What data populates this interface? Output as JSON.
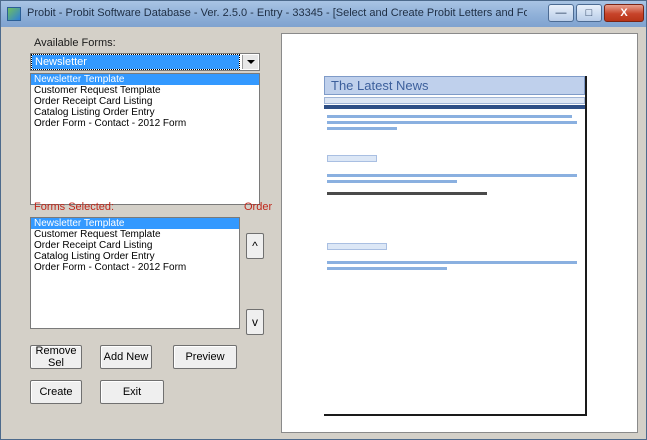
{
  "window": {
    "title": "Probit - Probit Software Database - Ver. 2.5.0 - Entry - 33345 - [Select and Create Probit Letters and Forms]",
    "minimize_label": "—",
    "maximize_label": "□",
    "close_label": "X"
  },
  "left_panel": {
    "available_label": "Available Forms:",
    "type_select": {
      "value": "Newsletter"
    },
    "available_items": [
      "Newsletter Template",
      "Customer Request Template",
      "Order Receipt Card Listing",
      "Catalog Listing Order Entry",
      "Order Form - Contact - 2012 Form"
    ],
    "selected_label": "Forms Selected:",
    "order_label": "Order",
    "selected_items": [
      "Newsletter Template",
      "Customer Request Template",
      "Order Receipt Card Listing",
      "Catalog Listing Order Entry",
      "Order Form - Contact - 2012 Form"
    ],
    "move_up_label": "^",
    "move_down_label": "v",
    "buttons": {
      "remove": "Remove Sel",
      "add_new": "Add New",
      "preview": "Preview",
      "create": "Create",
      "exit": "Exit"
    }
  },
  "preview": {
    "newsletter_title": "The Latest News"
  }
}
